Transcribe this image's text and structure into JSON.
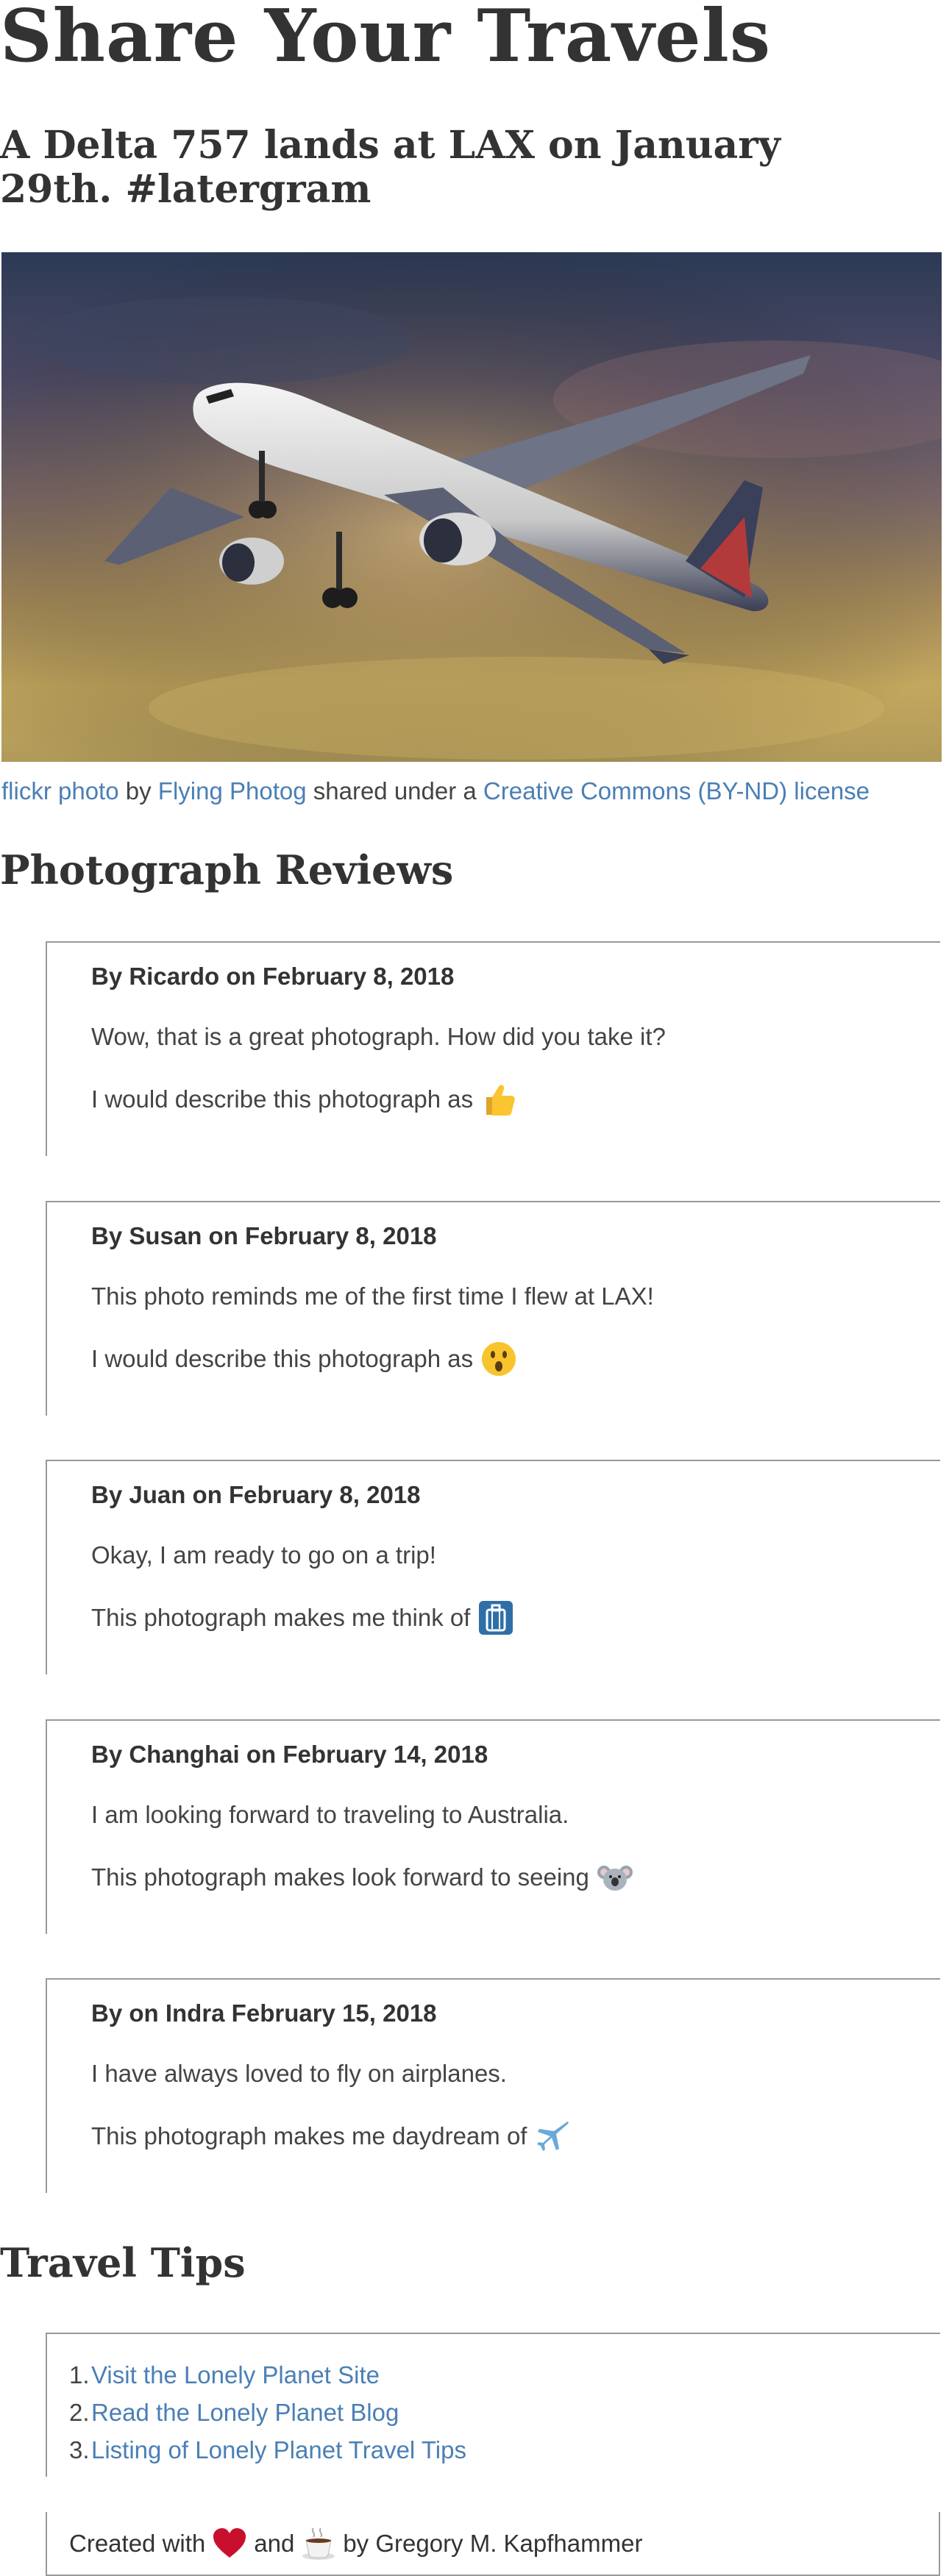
{
  "header": {
    "site_title": "Share Your Travels",
    "post_title": "A Delta 757 lands at LAX on January 29th. #latergram"
  },
  "photo": {
    "caption_link_1": "flickr photo",
    "caption_text_1": "by",
    "caption_link_2": "Flying Photog",
    "caption_text_2": "shared under a",
    "caption_link_3": "Creative Commons (BY-ND) license"
  },
  "reviews_section": {
    "title": "Photograph Reviews",
    "reviews": [
      {
        "byline": "By Ricardo on February 8, 2018",
        "body": "Wow, that is a great photograph. How did you take it?",
        "desc": "I would describe this photograph as",
        "icon": "thumbs-up-icon"
      },
      {
        "byline": "By Susan on February 8, 2018",
        "body": "This photo reminds me of the first time I flew at LAX!",
        "desc": "I would describe this photograph as",
        "icon": "surprised-face-icon"
      },
      {
        "byline": "By Juan on February 8, 2018",
        "body": "Okay, I am ready to go on a trip!",
        "desc": "This photograph makes me think of",
        "icon": "luggage-icon"
      },
      {
        "byline": "By Changhai on February 14, 2018",
        "body": "I am looking forward to traveling to Australia.",
        "desc": "This photograph makes look forward to seeing",
        "icon": "koala-icon"
      },
      {
        "byline": "By on Indra February 15, 2018",
        "body": "I have always loved to fly on airplanes.",
        "desc": "This photograph makes me daydream of",
        "icon": "airplane-icon"
      }
    ]
  },
  "tips_section": {
    "title": "Travel Tips",
    "items": [
      {
        "num": "1.",
        "label": "Visit the Lonely Planet Site"
      },
      {
        "num": "2.",
        "label": "Read the Lonely Planet Blog"
      },
      {
        "num": "3.",
        "label": "Listing of Lonely Planet Travel Tips"
      }
    ]
  },
  "footer": {
    "text_1": "Created with",
    "text_2": "and",
    "text_3": "by Gregory M. Kapfhammer",
    "icon_1": "heart-icon",
    "icon_2": "coffee-icon"
  },
  "colors": {
    "link": "#4a7fb5",
    "text": "#333333",
    "border": "#999999"
  }
}
